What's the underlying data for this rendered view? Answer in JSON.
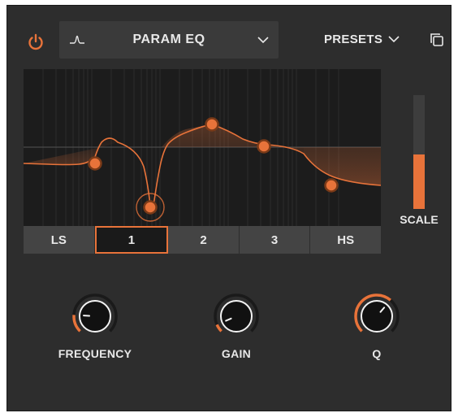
{
  "header": {
    "filter_type": "PARAM EQ",
    "presets_label": "PRESETS"
  },
  "bands": [
    {
      "label": "LS",
      "active": false
    },
    {
      "label": "1",
      "active": true
    },
    {
      "label": "2",
      "active": false
    },
    {
      "label": "3",
      "active": false
    },
    {
      "label": "HS",
      "active": false
    }
  ],
  "scale": {
    "label": "SCALE",
    "level": 0.48
  },
  "knobs": [
    {
      "name": "frequency",
      "label": "FREQUENCY",
      "value": 0.18
    },
    {
      "name": "gain",
      "label": "GAIN",
      "value": 0.08
    },
    {
      "name": "q",
      "label": "Q",
      "value": 0.65
    }
  ],
  "colors": {
    "accent": "#e8733a",
    "panel": "#2d2d2d",
    "display": "#1c1c1c",
    "text": "#e8e8e8"
  },
  "icons": {
    "power": "power-icon",
    "filter": "bell-filter-icon",
    "dropdown": "chevron-down-icon",
    "copy": "copy-icon"
  }
}
